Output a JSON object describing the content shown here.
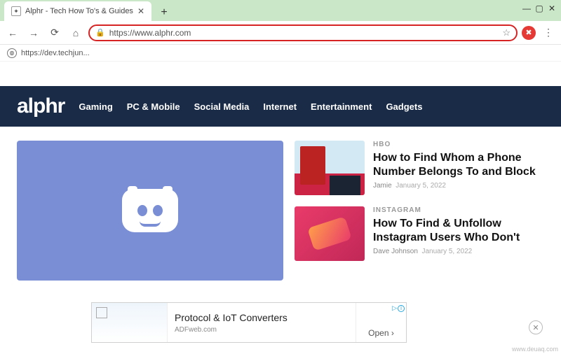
{
  "window": {
    "tab_title": "Alphr - Tech How To's & Guides",
    "min": "—",
    "max": "▢",
    "close": "✕"
  },
  "toolbar": {
    "url": "https://www.alphr.com"
  },
  "bookmark": {
    "label": "https://dev.techjun..."
  },
  "site": {
    "logo": "alphr",
    "nav": [
      "Gaming",
      "PC & Mobile",
      "Social Media",
      "Internet",
      "Entertainment",
      "Gadgets"
    ]
  },
  "articles": [
    {
      "category": "HBO",
      "title": "How to Find Whom a Phone Number Belongs To and Block",
      "author": "Jamie",
      "date": "January 5, 2022"
    },
    {
      "category": "INSTAGRAM",
      "title": "How To Find & Unfollow Instagram Users Who Don't",
      "author": "Dave Johnson",
      "date": "January 5, 2022"
    }
  ],
  "ad": {
    "label": "Ad",
    "headline": "Protocol & IoT Converters",
    "domain": "ADFweb.com",
    "cta": "Open",
    "info": "i",
    "x": "✕"
  },
  "watermark": "www.deuaq.com"
}
